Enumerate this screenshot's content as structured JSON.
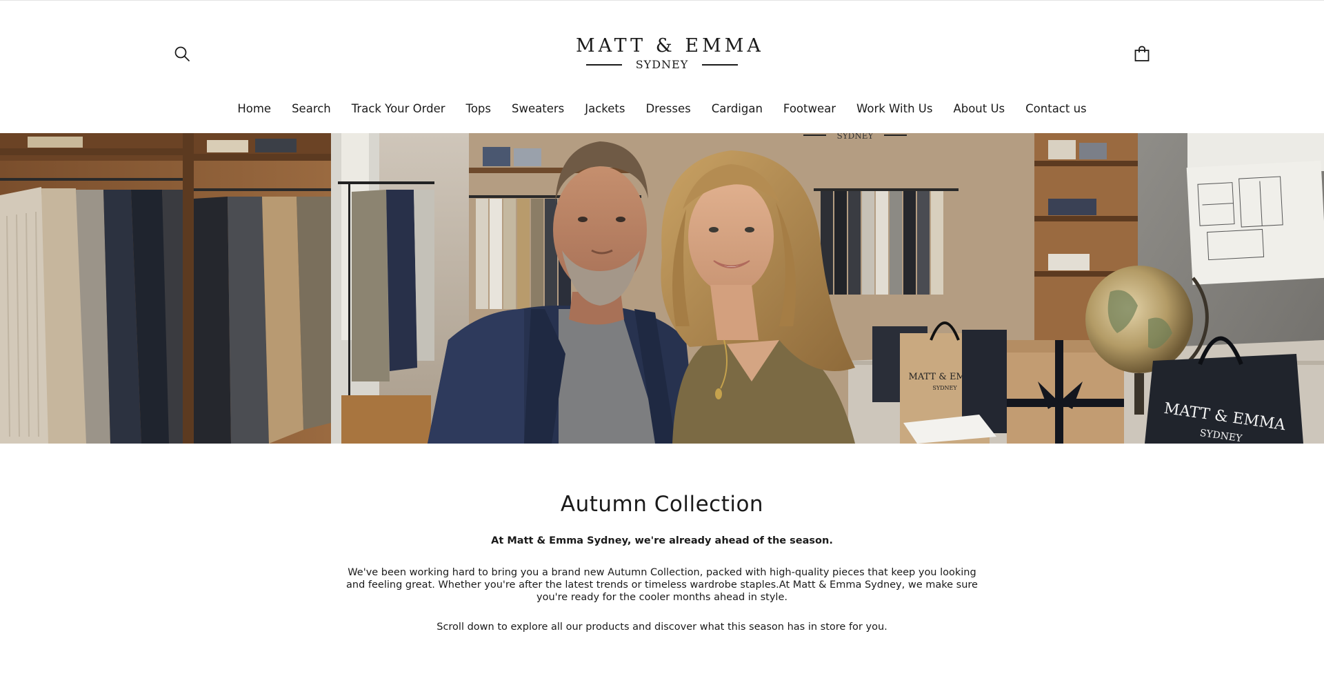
{
  "brand": {
    "name": "MATT & EMMA",
    "location": "SYDNEY"
  },
  "header": {
    "search_icon": "search-icon",
    "cart_icon": "shopping-bag-icon"
  },
  "nav": {
    "items": [
      {
        "label": "Home"
      },
      {
        "label": "Search"
      },
      {
        "label": "Track Your Order"
      },
      {
        "label": "Tops"
      },
      {
        "label": "Sweaters"
      },
      {
        "label": "Jackets"
      },
      {
        "label": "Dresses"
      },
      {
        "label": "Cardigan"
      },
      {
        "label": "Footwear"
      },
      {
        "label": "Work With Us"
      },
      {
        "label": "About Us"
      },
      {
        "label": "Contact us"
      }
    ]
  },
  "hero": {
    "bag_brand": "MATT & EMMA",
    "bag_location": "SYDNEY",
    "sign_location": "SYDNEY"
  },
  "main": {
    "title": "Autumn Collection",
    "lead": "At Matt & Emma Sydney, we're already ahead of the season.",
    "body": "We've been working hard to bring you a brand new Autumn Collection, packed with high-quality pieces that keep you looking and feeling great. Whether you're after the latest trends or timeless wardrobe staples.At Matt & Emma Sydney, we make sure you're ready for the cooler months ahead in style.",
    "scroll_note": "Scroll down to explore all our products and discover what this season has in store for you."
  },
  "colors": {
    "text": "#1a1a1a",
    "background": "#ffffff",
    "accent_wood": "#8a5a33",
    "navy": "#27324f"
  }
}
